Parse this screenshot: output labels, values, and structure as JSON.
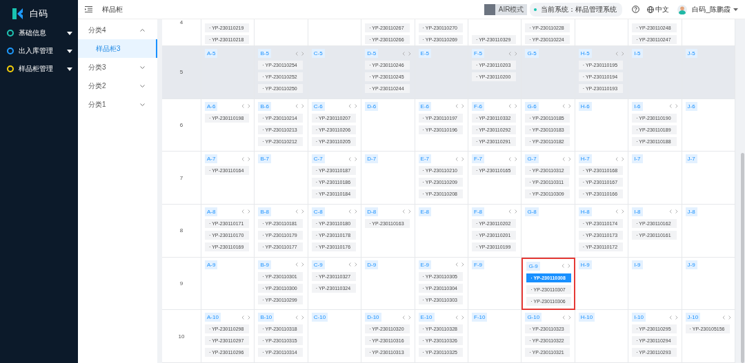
{
  "sidebar": {
    "logo": "白码",
    "menu": [
      {
        "label": "基础信息",
        "color": "#1fc6b4"
      },
      {
        "label": "出入库管理",
        "color": "#1e9bff"
      },
      {
        "label": "样品柜管理",
        "color": "#f5d00a"
      }
    ]
  },
  "topbar": {
    "breadcrumb": "样品柜",
    "air_mode": "AIR模式",
    "system": "当前系统：样品管理系统",
    "language": "中文",
    "user": "白码_陈鹏霞"
  },
  "tree": [
    {
      "label": "分类4",
      "expanded": true,
      "selected": false,
      "children": [
        {
          "label": "样品柜3",
          "selected": true
        }
      ]
    },
    {
      "label": "分类3",
      "expanded": false,
      "selected": false
    },
    {
      "label": "分类2",
      "expanded": false,
      "selected": false
    },
    {
      "label": "分类1",
      "expanded": false,
      "selected": false
    }
  ],
  "grid": {
    "rows": [
      {
        "number": "4",
        "highlighted": false,
        "cells": [
          {
            "highlighted": false,
            "chips": [
              {
                "text": "· YP-230110219",
                "selected": false
              },
              {
                "text": "· YP-230110218",
                "selected": false
              }
            ]
          },
          {
            "highlighted": false
          },
          {
            "highlighted": false
          },
          {
            "highlighted": false,
            "chips": [
              {
                "text": "· YP-230110267",
                "selected": false
              },
              {
                "text": "· YP-230110266",
                "selected": false
              }
            ]
          },
          {
            "highlighted": false,
            "chips": [
              {
                "text": "· YP-230110270",
                "selected": false
              },
              {
                "text": "· YP-230110269",
                "selected": false
              }
            ]
          },
          {
            "highlighted": false,
            "chips": [
              {
                "text": "· YP-230110329",
                "selected": false
              }
            ]
          },
          {
            "highlighted": false,
            "chips": [
              {
                "text": "· YP-230110228",
                "selected": false
              },
              {
                "text": "· YP-230110224",
                "selected": false
              }
            ]
          },
          {
            "highlighted": false
          },
          {
            "highlighted": false,
            "chips": [
              {
                "text": "· YP-230110248",
                "selected": false
              },
              {
                "text": "· YP-230110247",
                "selected": false
              }
            ]
          },
          {
            "highlighted": false
          }
        ]
      },
      {
        "number": "5",
        "highlighted": true,
        "cells": [
          {
            "label": "A-5",
            "highlighted": false
          },
          {
            "label": "B-5",
            "highlighted": false,
            "chips": [
              {
                "text": "· YP-230110254",
                "selected": false
              },
              {
                "text": "· YP-230110252",
                "selected": false
              },
              {
                "text": "· YP-230110250",
                "selected": false
              }
            ]
          },
          {
            "label": "C-5",
            "highlighted": false
          },
          {
            "label": "D-5",
            "highlighted": false,
            "chips": [
              {
                "text": "· YP-230110246",
                "selected": false
              },
              {
                "text": "· YP-230110245",
                "selected": false
              },
              {
                "text": "· YP-230110244",
                "selected": false
              }
            ]
          },
          {
            "label": "E-5",
            "highlighted": false
          },
          {
            "label": "F-5",
            "highlighted": false,
            "chips": [
              {
                "text": "· YP-230110203",
                "selected": false
              },
              {
                "text": "· YP-230110200",
                "selected": false
              }
            ]
          },
          {
            "label": "G-5",
            "highlighted": false
          },
          {
            "label": "H-5",
            "highlighted": false,
            "chips": [
              {
                "text": "· YP-230110195",
                "selected": false
              },
              {
                "text": "· YP-230110194",
                "selected": false
              },
              {
                "text": "· YP-230110193",
                "selected": false
              }
            ]
          },
          {
            "label": "I-5",
            "highlighted": false
          },
          {
            "label": "J-5",
            "highlighted": false
          }
        ]
      },
      {
        "number": "6",
        "highlighted": false,
        "cells": [
          {
            "label": "A-6",
            "highlighted": false,
            "chips": [
              {
                "text": "· YP-230110198",
                "selected": false
              }
            ]
          },
          {
            "label": "B-6",
            "highlighted": false,
            "chips": [
              {
                "text": "· YP-230110214",
                "selected": false
              },
              {
                "text": "· YP-230110213",
                "selected": false
              },
              {
                "text": "· YP-230110212",
                "selected": false
              }
            ]
          },
          {
            "label": "C-6",
            "highlighted": false,
            "chips": [
              {
                "text": "· YP-230110207",
                "selected": false
              },
              {
                "text": "· YP-230110206",
                "selected": false
              },
              {
                "text": "· YP-230110205",
                "selected": false
              }
            ]
          },
          {
            "label": "D-6",
            "highlighted": false
          },
          {
            "label": "E-6",
            "highlighted": false,
            "chips": [
              {
                "text": "· YP-230110197",
                "selected": false
              },
              {
                "text": "· YP-230110196",
                "selected": false
              }
            ]
          },
          {
            "label": "F-6",
            "highlighted": false,
            "chips": [
              {
                "text": "· YP-230110332",
                "selected": false
              },
              {
                "text": "· YP-230110292",
                "selected": false
              },
              {
                "text": "· YP-230110291",
                "selected": false
              }
            ]
          },
          {
            "label": "G-6",
            "highlighted": false,
            "chips": [
              {
                "text": "· YP-230110185",
                "selected": false
              },
              {
                "text": "· YP-230110183",
                "selected": false
              },
              {
                "text": "· YP-230110182",
                "selected": false
              }
            ]
          },
          {
            "label": "H-6",
            "highlighted": false
          },
          {
            "label": "I-6",
            "highlighted": false,
            "chips": [
              {
                "text": "· YP-230110190",
                "selected": false
              },
              {
                "text": "· YP-230110189",
                "selected": false
              },
              {
                "text": "· YP-230110188",
                "selected": false
              }
            ]
          },
          {
            "label": "J-6",
            "highlighted": false
          }
        ]
      },
      {
        "number": "7",
        "highlighted": false,
        "cells": [
          {
            "label": "A-7",
            "highlighted": false,
            "chips": [
              {
                "text": "· YP-230110164",
                "selected": false
              }
            ]
          },
          {
            "label": "B-7",
            "highlighted": false
          },
          {
            "label": "C-7",
            "highlighted": false,
            "chips": [
              {
                "text": "· YP-230110187",
                "selected": false
              },
              {
                "text": "· YP-230110186",
                "selected": false
              },
              {
                "text": "· YP-230110184",
                "selected": false
              }
            ]
          },
          {
            "label": "D-7",
            "highlighted": false
          },
          {
            "label": "E-7",
            "highlighted": false,
            "chips": [
              {
                "text": "· YP-230110210",
                "selected": false
              },
              {
                "text": "· YP-230110209",
                "selected": false
              },
              {
                "text": "· YP-230110208",
                "selected": false
              }
            ]
          },
          {
            "label": "F-7",
            "highlighted": false,
            "chips": [
              {
                "text": "· YP-230110165",
                "selected": false
              }
            ]
          },
          {
            "label": "G-7",
            "highlighted": false,
            "chips": [
              {
                "text": "· YP-230110312",
                "selected": false
              },
              {
                "text": "· YP-230110311",
                "selected": false
              },
              {
                "text": "· YP-230110309",
                "selected": false
              }
            ]
          },
          {
            "label": "H-7",
            "highlighted": false,
            "chips": [
              {
                "text": "· YP-230110168",
                "selected": false
              },
              {
                "text": "· YP-230110167",
                "selected": false
              },
              {
                "text": "· YP-230110166",
                "selected": false
              }
            ]
          },
          {
            "label": "I-7",
            "highlighted": false
          },
          {
            "label": "J-7",
            "highlighted": false
          }
        ]
      },
      {
        "number": "8",
        "highlighted": false,
        "cells": [
          {
            "label": "A-8",
            "highlighted": false,
            "chips": [
              {
                "text": "· YP-230110171",
                "selected": false
              },
              {
                "text": "· YP-230110170",
                "selected": false
              },
              {
                "text": "· YP-230110169",
                "selected": false
              }
            ]
          },
          {
            "label": "B-8",
            "highlighted": false,
            "chips": [
              {
                "text": "· YP-230110181",
                "selected": false
              },
              {
                "text": "· YP-230110179",
                "selected": false
              },
              {
                "text": "· YP-230110177",
                "selected": false
              }
            ]
          },
          {
            "label": "C-8",
            "highlighted": false,
            "chips": [
              {
                "text": "· YP-230110180",
                "selected": false
              },
              {
                "text": "· YP-230110178",
                "selected": false
              },
              {
                "text": "· YP-230110176",
                "selected": false
              }
            ]
          },
          {
            "label": "D-8",
            "highlighted": false,
            "chips": [
              {
                "text": "· YP-230110163",
                "selected": false
              }
            ]
          },
          {
            "label": "E-8",
            "highlighted": false
          },
          {
            "label": "F-8",
            "highlighted": false,
            "chips": [
              {
                "text": "· YP-230110202",
                "selected": false
              },
              {
                "text": "· YP-230110201",
                "selected": false
              },
              {
                "text": "· YP-230110199",
                "selected": false
              }
            ]
          },
          {
            "label": "G-8",
            "highlighted": false
          },
          {
            "label": "H-8",
            "highlighted": false,
            "chips": [
              {
                "text": "· YP-230110174",
                "selected": false
              },
              {
                "text": "· YP-230110173",
                "selected": false
              },
              {
                "text": "· YP-230110172",
                "selected": false
              }
            ]
          },
          {
            "label": "I-8",
            "highlighted": false,
            "chips": [
              {
                "text": "· YP-230110162",
                "selected": false
              },
              {
                "text": "· YP-230110161",
                "selected": false
              }
            ]
          },
          {
            "label": "J-8",
            "highlighted": false
          }
        ]
      },
      {
        "number": "9",
        "highlighted": false,
        "cells": [
          {
            "label": "A-9",
            "highlighted": false
          },
          {
            "label": "B-9",
            "highlighted": false,
            "chips": [
              {
                "text": "· YP-230110301",
                "selected": false
              },
              {
                "text": "· YP-230110300",
                "selected": false
              },
              {
                "text": "· YP-230110299",
                "selected": false
              }
            ]
          },
          {
            "label": "C-9",
            "highlighted": false,
            "chips": [
              {
                "text": "· YP-230110327",
                "selected": false
              },
              {
                "text": "· YP-230110324",
                "selected": false
              }
            ]
          },
          {
            "label": "D-9",
            "highlighted": false
          },
          {
            "label": "E-9",
            "highlighted": false,
            "chips": [
              {
                "text": "· YP-230110305",
                "selected": false
              },
              {
                "text": "· YP-230110304",
                "selected": false
              },
              {
                "text": "· YP-230110303",
                "selected": false
              }
            ]
          },
          {
            "label": "F-9",
            "highlighted": false
          },
          {
            "label": "G-9",
            "highlighted": true,
            "chips": [
              {
                "text": "· YP-230110308",
                "selected": true
              },
              {
                "text": "· YP-230110307",
                "selected": false
              },
              {
                "text": "· YP-230110306",
                "selected": false
              }
            ]
          },
          {
            "label": "H-9",
            "highlighted": false
          },
          {
            "label": "I-9",
            "highlighted": false
          },
          {
            "label": "J-9",
            "highlighted": false
          }
        ]
      },
      {
        "number": "10",
        "highlighted": false,
        "cells": [
          {
            "label": "A-10",
            "highlighted": false,
            "chips": [
              {
                "text": "· YP-230110298",
                "selected": false
              },
              {
                "text": "· YP-230110297",
                "selected": false
              },
              {
                "text": "· YP-230110296",
                "selected": false
              }
            ]
          },
          {
            "label": "B-10",
            "highlighted": false,
            "chips": [
              {
                "text": "· YP-230110318",
                "selected": false
              },
              {
                "text": "· YP-230110315",
                "selected": false
              },
              {
                "text": "· YP-230110314",
                "selected": false
              }
            ]
          },
          {
            "label": "C-10",
            "highlighted": false
          },
          {
            "label": "D-10",
            "highlighted": false,
            "chips": [
              {
                "text": "· YP-230110320",
                "selected": false
              },
              {
                "text": "· YP-230110316",
                "selected": false
              },
              {
                "text": "· YP-230110313",
                "selected": false
              }
            ]
          },
          {
            "label": "E-10",
            "highlighted": false,
            "chips": [
              {
                "text": "· YP-230110328",
                "selected": false
              },
              {
                "text": "· YP-230110326",
                "selected": false
              },
              {
                "text": "· YP-230110325",
                "selected": false
              }
            ]
          },
          {
            "label": "F-10",
            "highlighted": false
          },
          {
            "label": "G-10",
            "highlighted": false,
            "chips": [
              {
                "text": "· YP-230110323",
                "selected": false
              },
              {
                "text": "· YP-230110322",
                "selected": false
              },
              {
                "text": "· YP-230110321",
                "selected": false
              }
            ]
          },
          {
            "label": "H-10",
            "highlighted": false
          },
          {
            "label": "I-10",
            "highlighted": false,
            "chips": [
              {
                "text": "· YP-230110295",
                "selected": false
              },
              {
                "text": "· YP-230110294",
                "selected": false
              },
              {
                "text": "· YP-230110293",
                "selected": false
              }
            ]
          },
          {
            "label": "J-10",
            "highlighted": false,
            "chips": [
              {
                "text": "· YP-230105156",
                "selected": false
              }
            ]
          }
        ]
      }
    ]
  }
}
